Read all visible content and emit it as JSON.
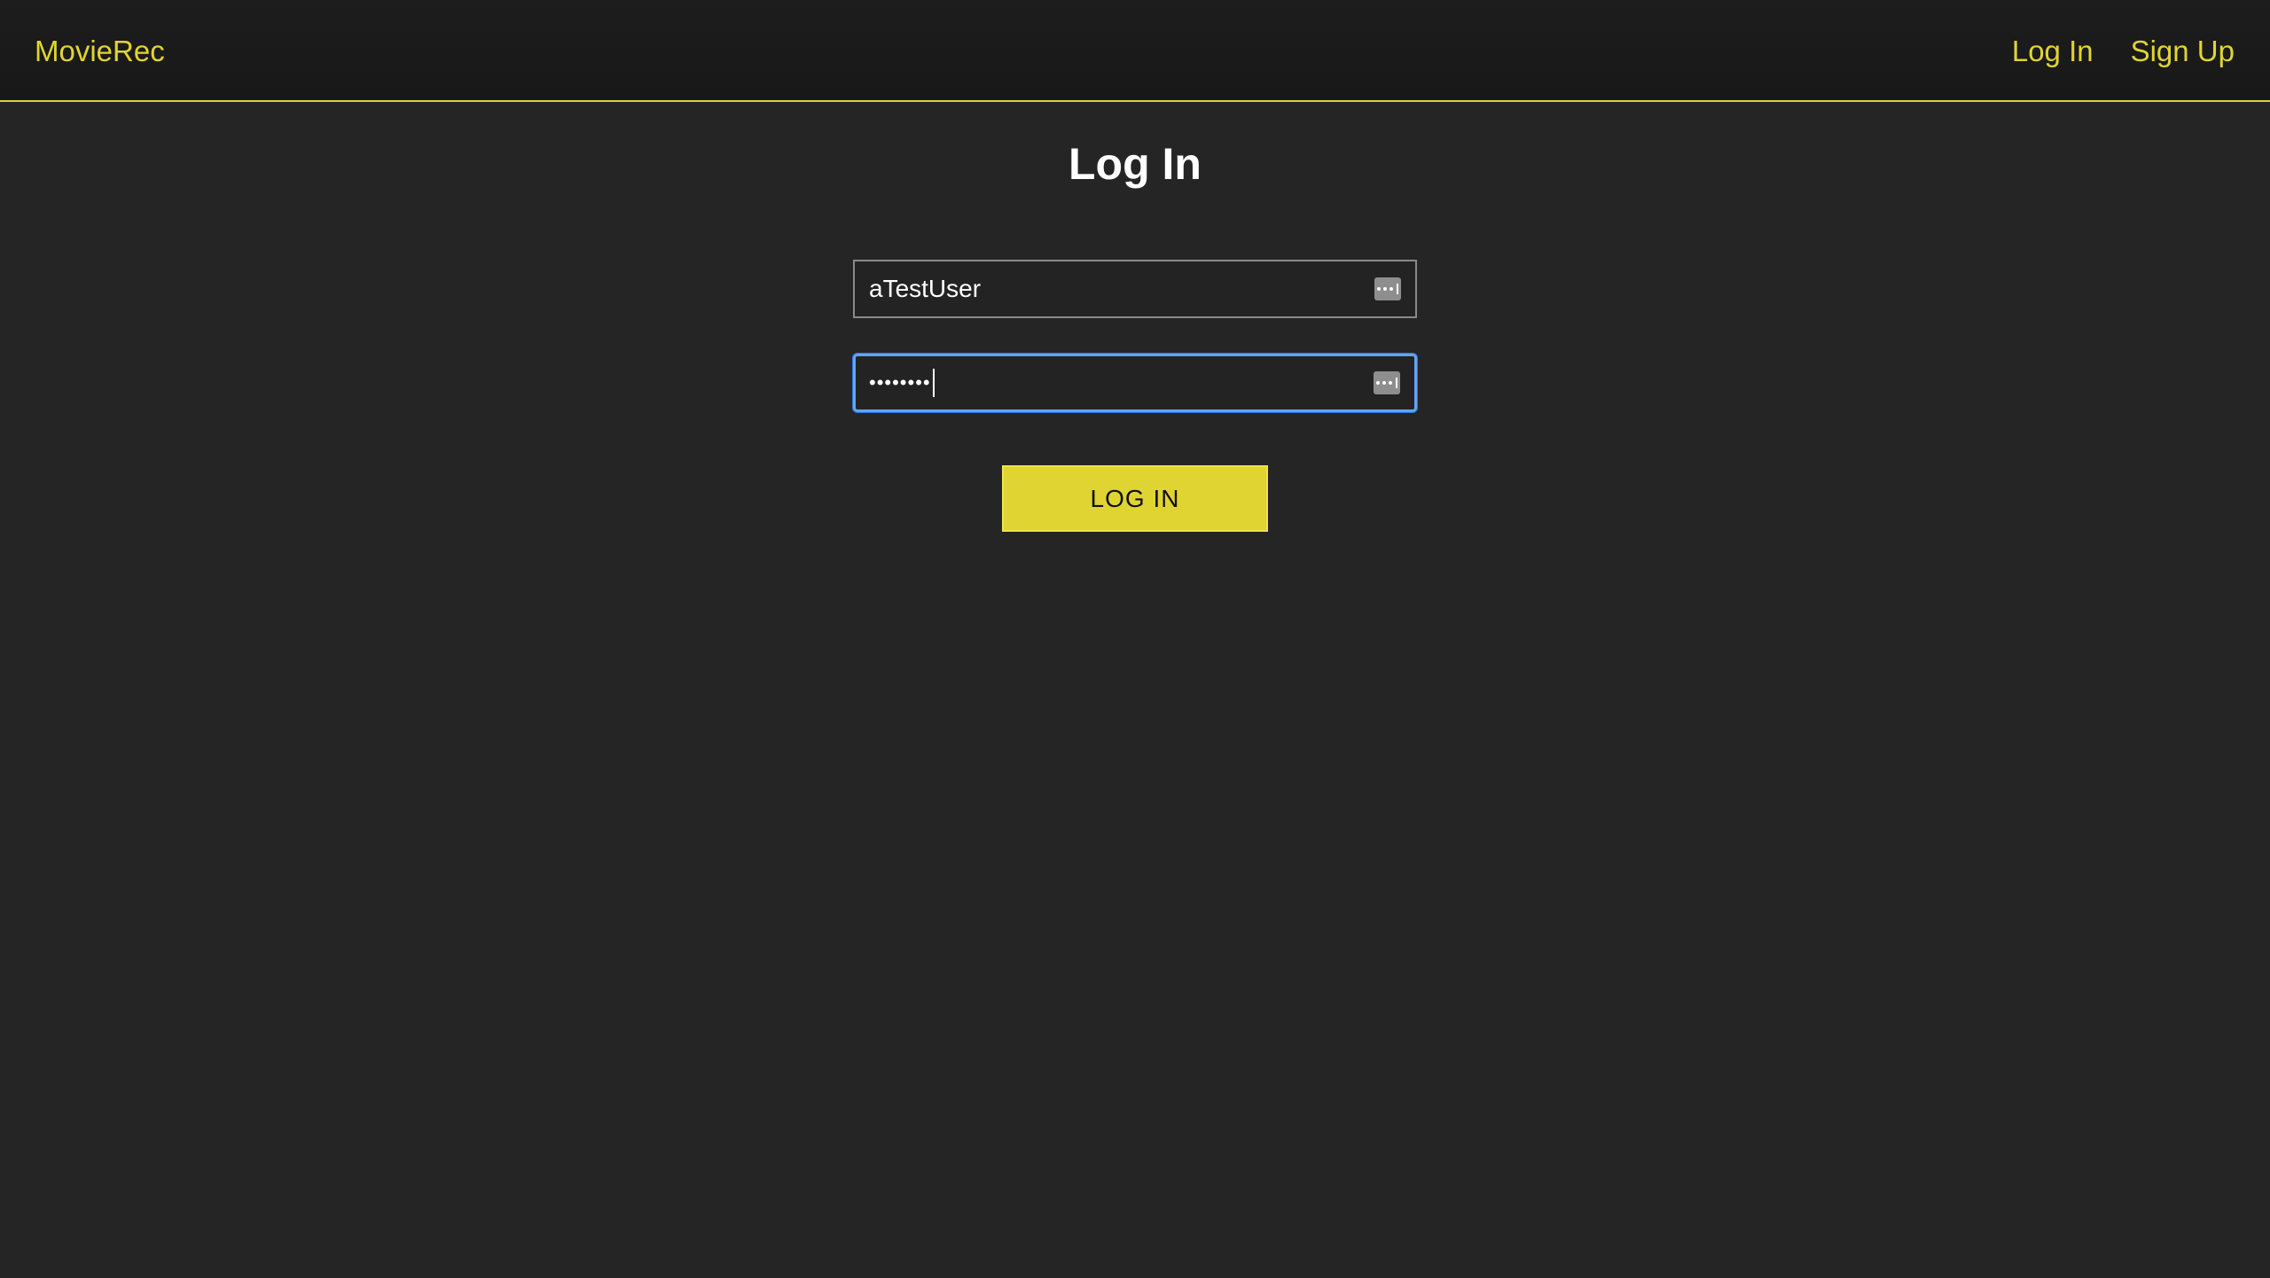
{
  "navbar": {
    "brand": "MovieRec",
    "links": [
      {
        "label": "Log In"
      },
      {
        "label": "Sign Up"
      }
    ]
  },
  "form": {
    "title": "Log In",
    "username": {
      "value": "aTestUser"
    },
    "password": {
      "masked_value": "••••••••"
    },
    "submit_label": "LOG IN"
  },
  "colors": {
    "accent": "#e0d433",
    "background": "#252525",
    "navbar": "#1a1a1a",
    "focus_ring": "#5fa6f0"
  },
  "icons": {
    "field_autofill": "password-manager-icon"
  }
}
